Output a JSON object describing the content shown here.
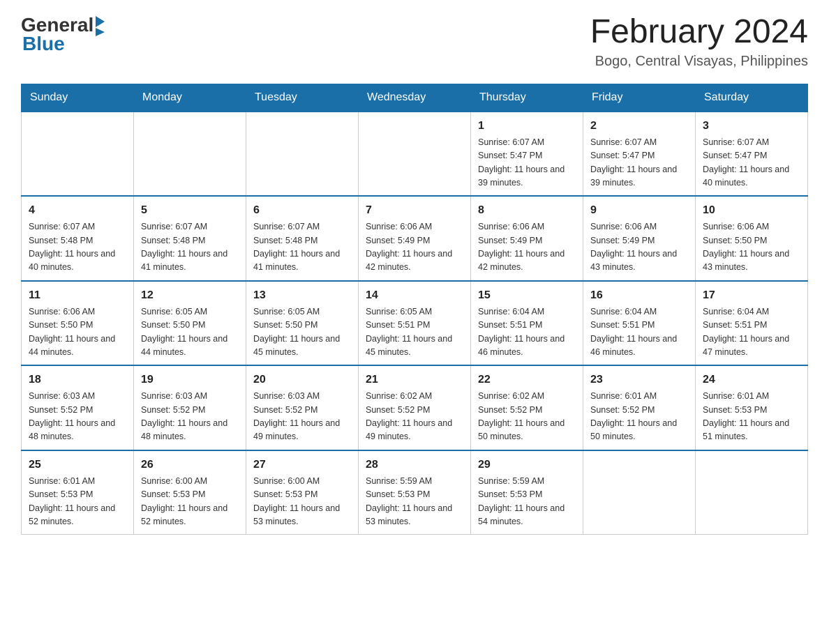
{
  "header": {
    "logo_general": "General",
    "logo_blue": "Blue",
    "month_title": "February 2024",
    "location": "Bogo, Central Visayas, Philippines"
  },
  "days_of_week": [
    "Sunday",
    "Monday",
    "Tuesday",
    "Wednesday",
    "Thursday",
    "Friday",
    "Saturday"
  ],
  "weeks": [
    {
      "days": [
        {
          "number": "",
          "info": ""
        },
        {
          "number": "",
          "info": ""
        },
        {
          "number": "",
          "info": ""
        },
        {
          "number": "",
          "info": ""
        },
        {
          "number": "1",
          "info": "Sunrise: 6:07 AM\nSunset: 5:47 PM\nDaylight: 11 hours\nand 39 minutes."
        },
        {
          "number": "2",
          "info": "Sunrise: 6:07 AM\nSunset: 5:47 PM\nDaylight: 11 hours\nand 39 minutes."
        },
        {
          "number": "3",
          "info": "Sunrise: 6:07 AM\nSunset: 5:47 PM\nDaylight: 11 hours\nand 40 minutes."
        }
      ]
    },
    {
      "days": [
        {
          "number": "4",
          "info": "Sunrise: 6:07 AM\nSunset: 5:48 PM\nDaylight: 11 hours\nand 40 minutes."
        },
        {
          "number": "5",
          "info": "Sunrise: 6:07 AM\nSunset: 5:48 PM\nDaylight: 11 hours\nand 41 minutes."
        },
        {
          "number": "6",
          "info": "Sunrise: 6:07 AM\nSunset: 5:48 PM\nDaylight: 11 hours\nand 41 minutes."
        },
        {
          "number": "7",
          "info": "Sunrise: 6:06 AM\nSunset: 5:49 PM\nDaylight: 11 hours\nand 42 minutes."
        },
        {
          "number": "8",
          "info": "Sunrise: 6:06 AM\nSunset: 5:49 PM\nDaylight: 11 hours\nand 42 minutes."
        },
        {
          "number": "9",
          "info": "Sunrise: 6:06 AM\nSunset: 5:49 PM\nDaylight: 11 hours\nand 43 minutes."
        },
        {
          "number": "10",
          "info": "Sunrise: 6:06 AM\nSunset: 5:50 PM\nDaylight: 11 hours\nand 43 minutes."
        }
      ]
    },
    {
      "days": [
        {
          "number": "11",
          "info": "Sunrise: 6:06 AM\nSunset: 5:50 PM\nDaylight: 11 hours\nand 44 minutes."
        },
        {
          "number": "12",
          "info": "Sunrise: 6:05 AM\nSunset: 5:50 PM\nDaylight: 11 hours\nand 44 minutes."
        },
        {
          "number": "13",
          "info": "Sunrise: 6:05 AM\nSunset: 5:50 PM\nDaylight: 11 hours\nand 45 minutes."
        },
        {
          "number": "14",
          "info": "Sunrise: 6:05 AM\nSunset: 5:51 PM\nDaylight: 11 hours\nand 45 minutes."
        },
        {
          "number": "15",
          "info": "Sunrise: 6:04 AM\nSunset: 5:51 PM\nDaylight: 11 hours\nand 46 minutes."
        },
        {
          "number": "16",
          "info": "Sunrise: 6:04 AM\nSunset: 5:51 PM\nDaylight: 11 hours\nand 46 minutes."
        },
        {
          "number": "17",
          "info": "Sunrise: 6:04 AM\nSunset: 5:51 PM\nDaylight: 11 hours\nand 47 minutes."
        }
      ]
    },
    {
      "days": [
        {
          "number": "18",
          "info": "Sunrise: 6:03 AM\nSunset: 5:52 PM\nDaylight: 11 hours\nand 48 minutes."
        },
        {
          "number": "19",
          "info": "Sunrise: 6:03 AM\nSunset: 5:52 PM\nDaylight: 11 hours\nand 48 minutes."
        },
        {
          "number": "20",
          "info": "Sunrise: 6:03 AM\nSunset: 5:52 PM\nDaylight: 11 hours\nand 49 minutes."
        },
        {
          "number": "21",
          "info": "Sunrise: 6:02 AM\nSunset: 5:52 PM\nDaylight: 11 hours\nand 49 minutes."
        },
        {
          "number": "22",
          "info": "Sunrise: 6:02 AM\nSunset: 5:52 PM\nDaylight: 11 hours\nand 50 minutes."
        },
        {
          "number": "23",
          "info": "Sunrise: 6:01 AM\nSunset: 5:52 PM\nDaylight: 11 hours\nand 50 minutes."
        },
        {
          "number": "24",
          "info": "Sunrise: 6:01 AM\nSunset: 5:53 PM\nDaylight: 11 hours\nand 51 minutes."
        }
      ]
    },
    {
      "days": [
        {
          "number": "25",
          "info": "Sunrise: 6:01 AM\nSunset: 5:53 PM\nDaylight: 11 hours\nand 52 minutes."
        },
        {
          "number": "26",
          "info": "Sunrise: 6:00 AM\nSunset: 5:53 PM\nDaylight: 11 hours\nand 52 minutes."
        },
        {
          "number": "27",
          "info": "Sunrise: 6:00 AM\nSunset: 5:53 PM\nDaylight: 11 hours\nand 53 minutes."
        },
        {
          "number": "28",
          "info": "Sunrise: 5:59 AM\nSunset: 5:53 PM\nDaylight: 11 hours\nand 53 minutes."
        },
        {
          "number": "29",
          "info": "Sunrise: 5:59 AM\nSunset: 5:53 PM\nDaylight: 11 hours\nand 54 minutes."
        },
        {
          "number": "",
          "info": ""
        },
        {
          "number": "",
          "info": ""
        }
      ]
    }
  ]
}
